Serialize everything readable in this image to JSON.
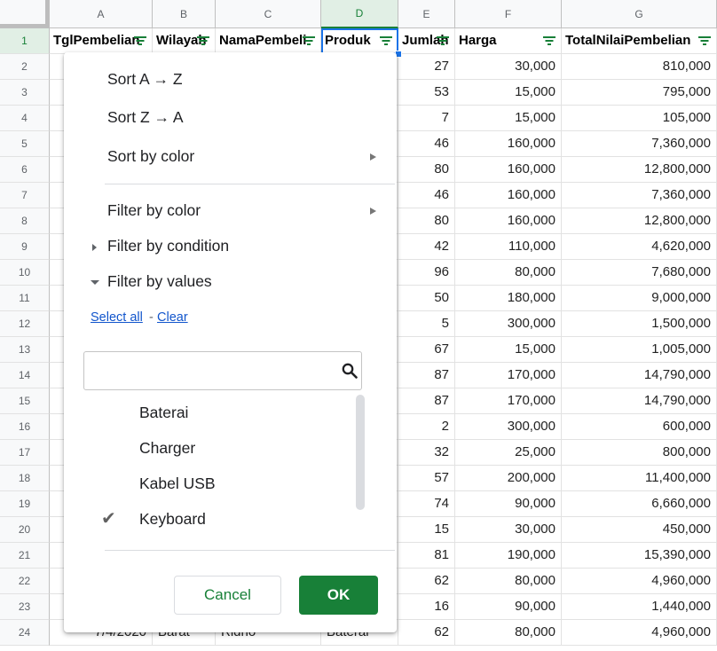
{
  "columns": [
    "A",
    "B",
    "C",
    "D",
    "E",
    "F",
    "G"
  ],
  "header_row": [
    "TglPembelian",
    "Wilayah",
    "NamaPembeli",
    "Produk",
    "Jumlah",
    "Harga",
    "TotalNilaiPembelian"
  ],
  "rows": [
    {
      "n": "1"
    },
    {
      "n": "2",
      "e": "27",
      "f": "30,000",
      "g": "810,000"
    },
    {
      "n": "3",
      "e": "53",
      "f": "15,000",
      "g": "795,000"
    },
    {
      "n": "4",
      "e": "7",
      "f": "15,000",
      "g": "105,000"
    },
    {
      "n": "5",
      "e": "46",
      "f": "160,000",
      "g": "7,360,000"
    },
    {
      "n": "6",
      "e": "80",
      "f": "160,000",
      "g": "12,800,000"
    },
    {
      "n": "7",
      "e": "46",
      "f": "160,000",
      "g": "7,360,000"
    },
    {
      "n": "8",
      "e": "80",
      "f": "160,000",
      "g": "12,800,000"
    },
    {
      "n": "9",
      "e": "42",
      "f": "110,000",
      "g": "4,620,000"
    },
    {
      "n": "10",
      "e": "96",
      "f": "80,000",
      "g": "7,680,000"
    },
    {
      "n": "11",
      "e": "50",
      "f": "180,000",
      "g": "9,000,000"
    },
    {
      "n": "12",
      "e": "5",
      "f": "300,000",
      "g": "1,500,000"
    },
    {
      "n": "13",
      "e": "67",
      "f": "15,000",
      "g": "1,005,000"
    },
    {
      "n": "14",
      "e": "87",
      "f": "170,000",
      "g": "14,790,000"
    },
    {
      "n": "15",
      "e": "87",
      "f": "170,000",
      "g": "14,790,000"
    },
    {
      "n": "16",
      "e": "2",
      "f": "300,000",
      "g": "600,000"
    },
    {
      "n": "17",
      "e": "32",
      "f": "25,000",
      "g": "800,000"
    },
    {
      "n": "18",
      "e": "57",
      "f": "200,000",
      "g": "11,400,000"
    },
    {
      "n": "19",
      "e": "74",
      "f": "90,000",
      "g": "6,660,000"
    },
    {
      "n": "20",
      "e": "15",
      "f": "30,000",
      "g": "450,000"
    },
    {
      "n": "21",
      "e": "81",
      "f": "190,000",
      "g": "15,390,000"
    },
    {
      "n": "22",
      "e": "62",
      "f": "80,000",
      "g": "4,960,000"
    },
    {
      "n": "23",
      "e": "16",
      "f": "90,000",
      "g": "1,440,000"
    },
    {
      "n": "24",
      "a": "7/4/2020",
      "b": "Barat",
      "c": "Ridho",
      "d": "Baterai",
      "e": "62",
      "f": "80,000",
      "g": "4,960,000"
    }
  ],
  "menu": {
    "sort_az": "Sort A → Z",
    "sort_za": "Sort Z → A",
    "sort_color": "Sort by color",
    "filter_color": "Filter by color",
    "filter_condition": "Filter by condition",
    "filter_values": "Filter by values",
    "select_all": "Select all",
    "dash": "-",
    "clear": "Clear",
    "search_placeholder": "",
    "values": [
      {
        "label": "Baterai",
        "checked": false
      },
      {
        "label": "Charger",
        "checked": false
      },
      {
        "label": "Kabel USB",
        "checked": false
      },
      {
        "label": "Keyboard",
        "checked": true
      }
    ],
    "check_glyph": "✔",
    "cancel": "Cancel",
    "ok": "OK"
  },
  "icons": {
    "filter": "filter-icon",
    "submenu": "chevron-right-icon",
    "search": "search-icon",
    "check": "check-icon"
  },
  "colors": {
    "accent_green": "#188038",
    "selection_blue": "#1a73e8",
    "link_blue": "#1155cc"
  }
}
